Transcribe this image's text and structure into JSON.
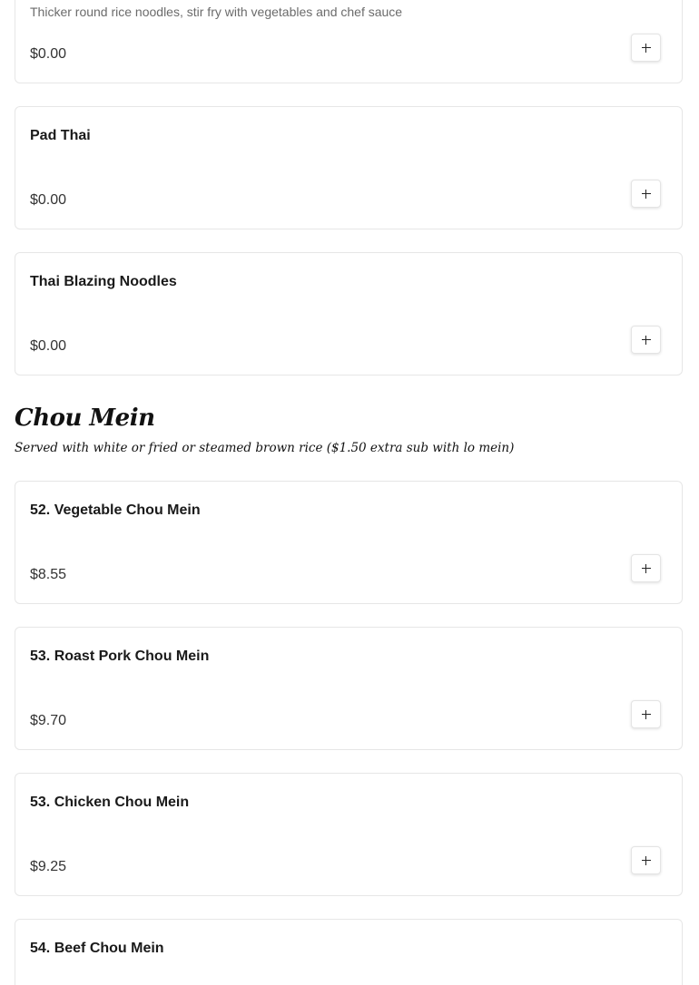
{
  "top_item": {
    "description": "Thicker round rice noodles, stir fry with vegetables and chef sauce",
    "price": "$0.00"
  },
  "noodle_items": [
    {
      "name": "Pad Thai",
      "price": "$0.00"
    },
    {
      "name": "Thai Blazing Noodles",
      "price": "$0.00"
    }
  ],
  "section": {
    "title": "Chou Mein",
    "subtitle": "Served with white or fried or steamed brown rice  ($1.50 extra sub with lo mein)"
  },
  "chou_mein_items": [
    {
      "name": "52. Vegetable Chou Mein",
      "price": "$8.55"
    },
    {
      "name": "53. Roast Pork Chou Mein",
      "price": "$9.70"
    },
    {
      "name": "53. Chicken Chou Mein",
      "price": "$9.25"
    },
    {
      "name": "54. Beef Chou Mein",
      "price": ""
    }
  ],
  "icons": {
    "add": "plus-icon"
  }
}
